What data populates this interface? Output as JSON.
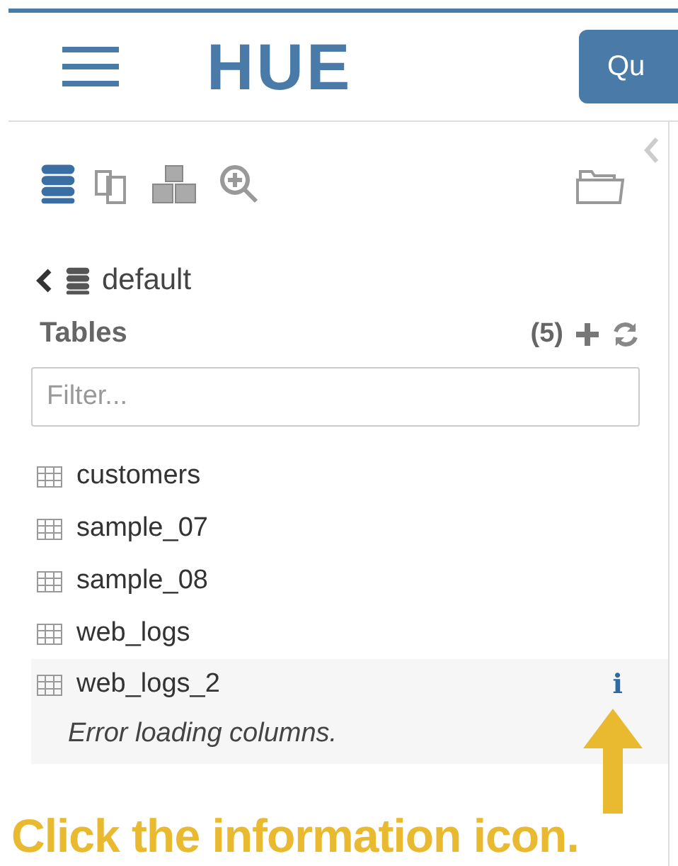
{
  "header": {
    "logo": "HUE",
    "button": "Qu"
  },
  "sidebar": {
    "database": "default",
    "section_title": "Tables",
    "count": "(5)",
    "filter": {
      "placeholder": "Filter..."
    },
    "tables": [
      {
        "name": "customers",
        "selected": false
      },
      {
        "name": "sample_07",
        "selected": false
      },
      {
        "name": "sample_08",
        "selected": false
      },
      {
        "name": "web_logs",
        "selected": false
      },
      {
        "name": "web_logs_2",
        "selected": true,
        "info_icon": "i",
        "error": "Error loading columns."
      }
    ]
  },
  "annotation": {
    "caption": "Click the information icon."
  }
}
